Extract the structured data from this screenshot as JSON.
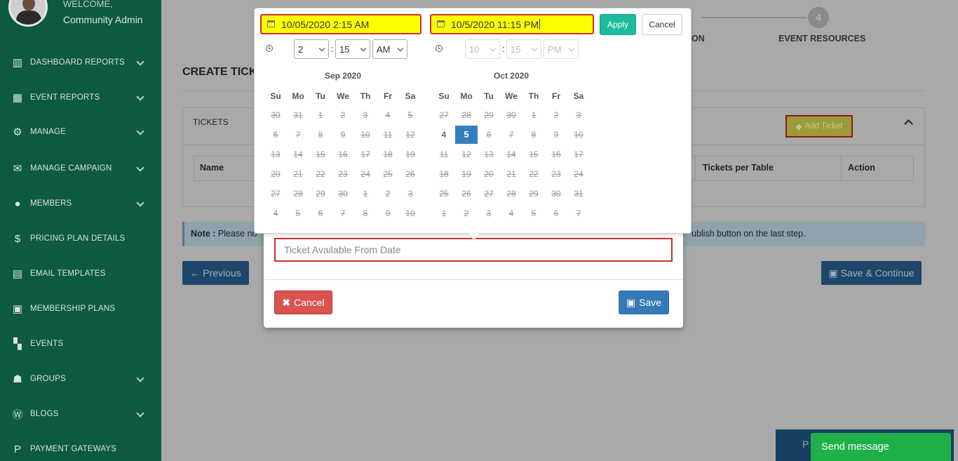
{
  "sidebar": {
    "welcome": "WELCOME,",
    "role": "Community Admin",
    "items": [
      {
        "label": "DASHBOARD REPORTS",
        "icon": "bar-chart-icon",
        "chevron": true
      },
      {
        "label": "EVENT REPORTS",
        "icon": "table-icon",
        "chevron": true
      },
      {
        "label": "MANAGE",
        "icon": "gears-icon",
        "chevron": true
      },
      {
        "label": "MANAGE CAMPAIGN",
        "icon": "envelope-icon",
        "chevron": true
      },
      {
        "label": "MEMBERS",
        "icon": "user-icon",
        "chevron": true
      },
      {
        "label": "PRICING PLAN DETAILS",
        "icon": "dollar-icon",
        "chevron": false
      },
      {
        "label": "EMAIL TEMPLATES",
        "icon": "newspaper-icon",
        "chevron": false
      },
      {
        "label": "MEMBERSHIP PLANS",
        "icon": "money-icon",
        "chevron": false
      },
      {
        "label": "EVENTS",
        "icon": "grid-icon",
        "chevron": false
      },
      {
        "label": "GROUPS",
        "icon": "users-icon",
        "chevron": true
      },
      {
        "label": "BLOGS",
        "icon": "wordpress-icon",
        "chevron": true
      },
      {
        "label": "PAYMENT GATEWAYS",
        "icon": "paypal-icon",
        "chevron": false
      }
    ]
  },
  "wizard": {
    "step_number": "4",
    "step_label": "EVENT RESOURCES",
    "prev_step_fragment": "ON"
  },
  "page": {
    "title": "CREATE TICK",
    "tickets_header": "TICKETS",
    "add_ticket": "Add Ticket",
    "columns": [
      "Name",
      "Tickets per Table",
      "Action"
    ],
    "note_label": "Note :",
    "note_text": " Please no",
    "note_tail": "ublish button on the last step.",
    "previous": "Previous",
    "save_continue": "Save & Continue",
    "publish_fragment": "P",
    "send_message": "Send message"
  },
  "modal": {
    "placeholder": "Ticket Available From Date",
    "cancel": "Cancel",
    "save": "Save"
  },
  "picker": {
    "start_value": "10/05/2020 2:15 AM",
    "end_value": "10/5/2020 11:15 PM",
    "apply": "Apply",
    "cancel": "Cancel",
    "left_time": {
      "hour": "2",
      "minute": "15",
      "ampm": "AM"
    },
    "right_time": {
      "hour": "10",
      "minute": "15",
      "ampm": "PM"
    },
    "weekdays": [
      "Su",
      "Mo",
      "Tu",
      "We",
      "Th",
      "Fr",
      "Sa"
    ],
    "left_month": "Sep 2020",
    "right_month": "Oct 2020",
    "left_days": [
      "30",
      "31",
      "1",
      "2",
      "3",
      "4",
      "5",
      "6",
      "7",
      "8",
      "9",
      "10",
      "11",
      "12",
      "13",
      "14",
      "15",
      "16",
      "17",
      "18",
      "19",
      "20",
      "21",
      "22",
      "23",
      "24",
      "25",
      "26",
      "27",
      "28",
      "29",
      "30",
      "1",
      "2",
      "3",
      "4",
      "5",
      "6",
      "7",
      "8",
      "9",
      "10"
    ],
    "right_days": [
      "27",
      "28",
      "29",
      "30",
      "1",
      "2",
      "3",
      "4",
      "5",
      "6",
      "7",
      "8",
      "9",
      "10",
      "11",
      "12",
      "13",
      "14",
      "15",
      "16",
      "17",
      "18",
      "19",
      "20",
      "21",
      "22",
      "23",
      "24",
      "25",
      "26",
      "27",
      "28",
      "29",
      "30",
      "31",
      "1",
      "2",
      "3",
      "4",
      "5",
      "6",
      "7"
    ],
    "right_selected_index": 8,
    "right_normal_index": 7,
    "accent": "#357ebd",
    "highlight": "#ffff00"
  }
}
